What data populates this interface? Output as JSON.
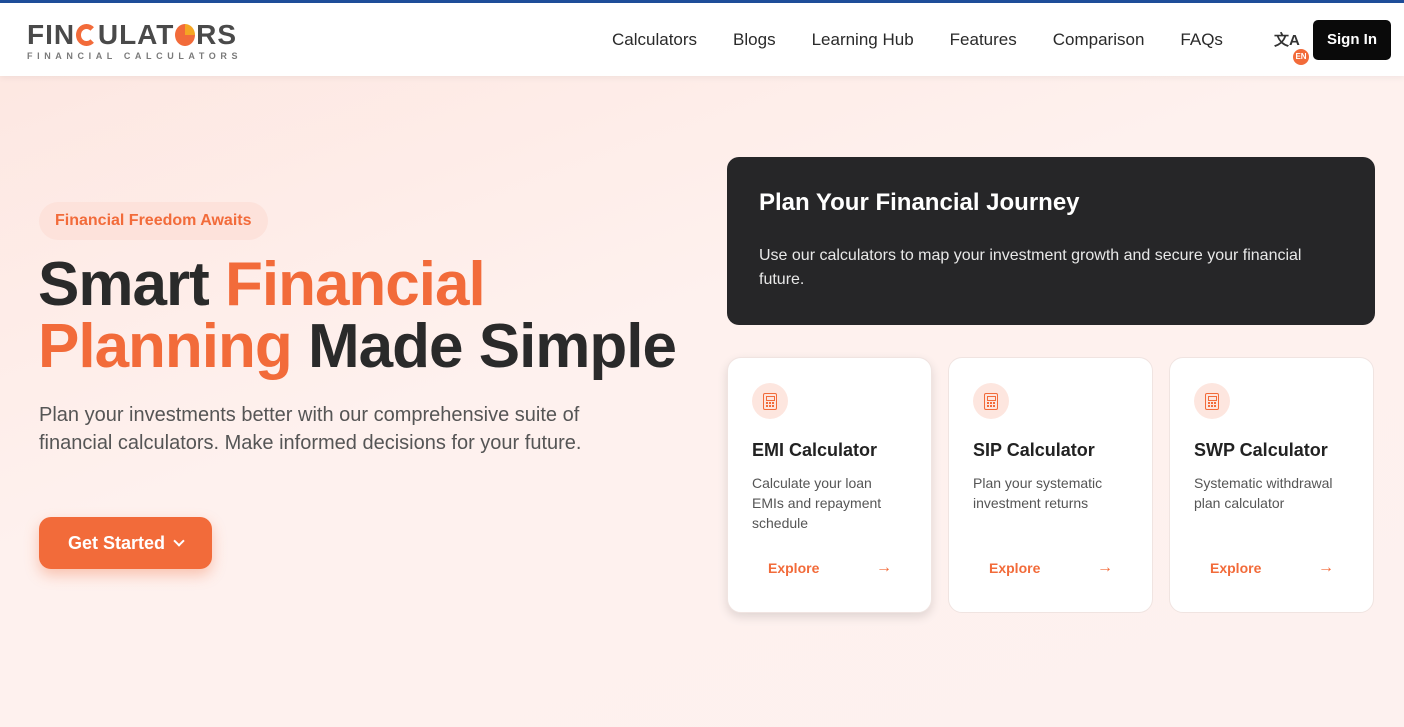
{
  "brand": {
    "name_part1": "FIN",
    "name_part2": "ULAT",
    "name_part3": "RS",
    "tagline": "FINANCIAL CALCULATORS",
    "accent_color": "#f26b3a"
  },
  "nav": {
    "links": [
      "Calculators",
      "Blogs",
      "Learning Hub",
      "Features",
      "Comparison",
      "FAQs"
    ],
    "lang_glyph": "文A",
    "lang_badge": "EN",
    "signin_label": "Sign In"
  },
  "hero": {
    "pill": "Financial Freedom Awaits",
    "headline_1": "Smart ",
    "headline_accent": "Financial Planning",
    "headline_2": " Made Simple",
    "lead": "Plan your investments better with our comprehensive suite of financial calculators. Make informed decisions for your future.",
    "cta_label": "Get Started"
  },
  "journey": {
    "title": "Plan Your Financial Journey",
    "text": "Use our calculators to map your investment growth and secure your financial future."
  },
  "cards": [
    {
      "title": "EMI Calculator",
      "desc": "Calculate your loan EMIs and repayment schedule",
      "link": "Explore",
      "icon": "calculator-icon"
    },
    {
      "title": "SIP Calculator",
      "desc": "Plan your systematic investment returns",
      "link": "Explore",
      "icon": "calculator-icon"
    },
    {
      "title": "SWP Calculator",
      "desc": "Systematic withdrawal plan calculator",
      "link": "Explore",
      "icon": "calculator-icon"
    }
  ]
}
